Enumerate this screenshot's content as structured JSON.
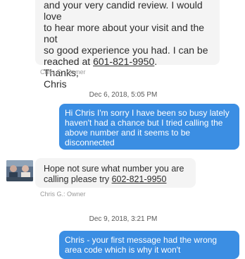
{
  "messages": [
    {
      "text_lines": [
        "and your very candid review. I would love",
        "to hear more about your visit and the not",
        "so good experience you had. I can be",
        "reached at "
      ],
      "phone": "601-821-9950",
      "phone_suffix": ".",
      "closing": "Thanks,\nChris",
      "sender": "Chris G.: Owner"
    },
    {
      "timestamp": "Dec 6, 2018, 5:05 PM",
      "text": "Hi Chris I'm sorry I have been so busy lately haven't had a chance but I tried calling the above number and it seems to be disconnected"
    },
    {
      "text": "Hope not sure what number you are calling please try ",
      "phone": "602-821-9950",
      "sender": "Chris G.: Owner"
    },
    {
      "timestamp": "Dec 9, 2018, 3:21 PM",
      "text": "Chris - your first message had the wrong area code which is why it won't"
    }
  ],
  "colors": {
    "owner_bubble": "#f4f4f4",
    "user_bubble": "#3b8ee3",
    "text": "#2d2d2d"
  }
}
